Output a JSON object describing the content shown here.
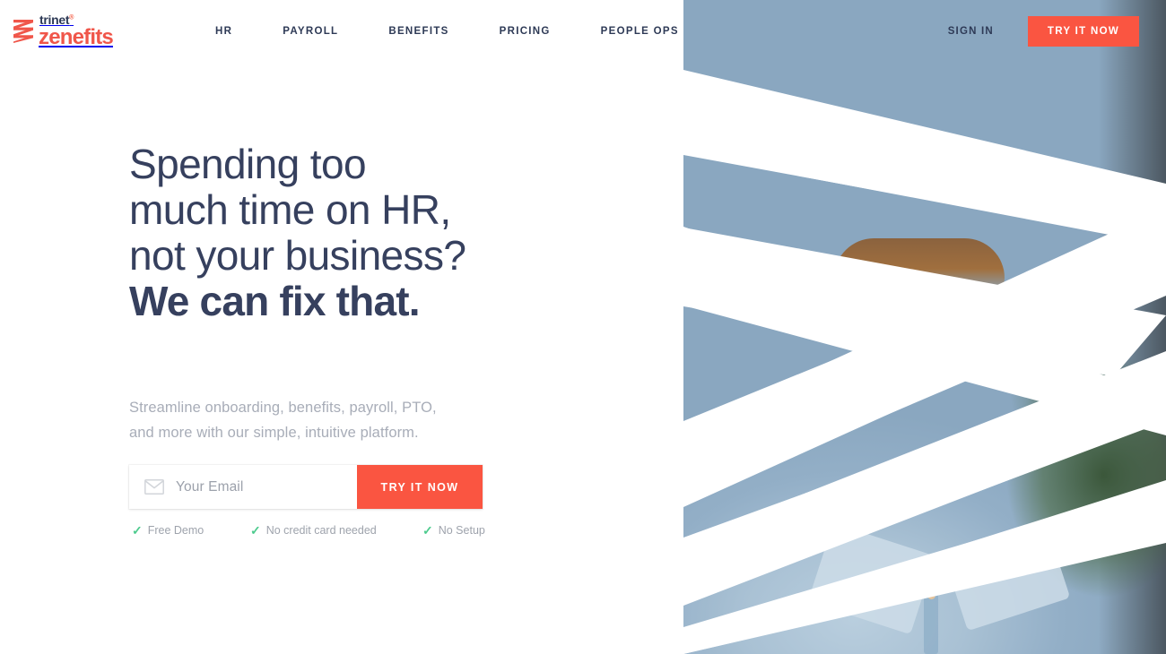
{
  "brand": {
    "name_top": "trinet",
    "trademark": "®",
    "name_bottom": "zenefits",
    "mark_icon": "zigzag-z-icon",
    "color_navy": "#2e3a56",
    "color_coral": "#f0564a"
  },
  "header": {
    "nav": [
      {
        "label": "HR"
      },
      {
        "label": "PAYROLL"
      },
      {
        "label": "BENEFITS"
      },
      {
        "label": "PRICING"
      },
      {
        "label": "PEOPLE OPS"
      }
    ],
    "sign_in": "SIGN IN",
    "cta": "TRY IT NOW"
  },
  "hero": {
    "headline_line1": "Spending too",
    "headline_line2": "much time on HR,",
    "headline_line3": "not your business?",
    "headline_line4": "We can fix that.",
    "subhead_line1": "Streamline onboarding, benefits, payroll, PTO,",
    "subhead_line2": "and more with our simple, intuitive platform.",
    "form": {
      "email_placeholder": "Your Email",
      "email_value": "",
      "email_icon": "envelope-icon",
      "submit": "TRY IT NOW"
    },
    "perks": [
      {
        "icon": "check-icon",
        "label": "Free Demo"
      },
      {
        "icon": "check-icon",
        "label": "No credit card needed"
      },
      {
        "icon": "check-icon",
        "label": "No Setup"
      }
    ]
  },
  "media": {
    "description": "smiling woman with auburn hair in denim shirt behind white zigzag bands",
    "overlay_icon": "zigzag-band-overlay"
  },
  "colors": {
    "accent_coral": "#fa5541",
    "headline_navy": "#36405e",
    "muted_grey": "#a8adb8",
    "check_green": "#4ecb8e"
  }
}
